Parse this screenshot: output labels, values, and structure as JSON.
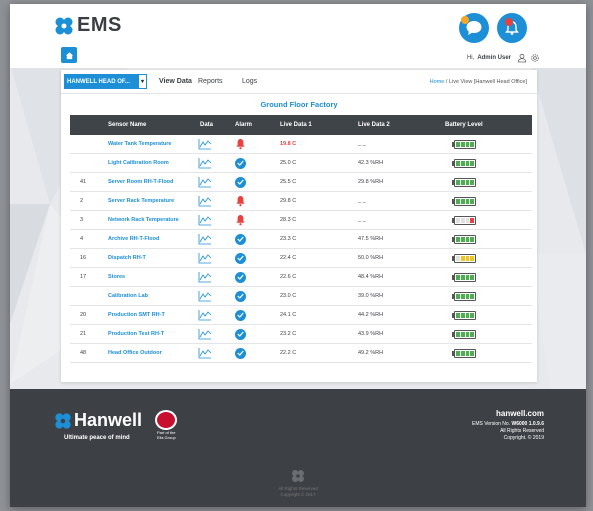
{
  "header": {
    "app_name": "EMS",
    "greeting": "Hi,",
    "user_name": "Admin User",
    "colors": {
      "accent": "#1c8fd6",
      "chat_badge": "#f5a623",
      "bell_badge": "#e8413e"
    }
  },
  "nav": {
    "site_select": "HANWELL HEAD OF...",
    "tabs": [
      {
        "label": "View Data",
        "active": true
      },
      {
        "label": "Reports",
        "active": false
      },
      {
        "label": "Logs",
        "active": false
      }
    ],
    "breadcrumb_home": "Home",
    "breadcrumb_sep": " / ",
    "breadcrumb_current": "Live View [Hanwell Head Office]"
  },
  "section_title": "Ground Floor Factory",
  "table": {
    "headers": {
      "sensor_name": "Sensor Name",
      "data": "Data",
      "alarm": "Alarm",
      "live1": "Live Data 1",
      "live2": "Live Data 2",
      "battery": "Battery Level"
    },
    "rows": [
      {
        "id": "",
        "name": "Water Tank Temperature",
        "alarm": "alarm",
        "live1": "19.8 C",
        "live2": "_ _",
        "battery": {
          "level": 4,
          "color": "#4caf50"
        }
      },
      {
        "id": "",
        "name": "Light Calibration Room",
        "alarm": "ok",
        "live1": "25.0 C",
        "live2": "42.3 %RH",
        "battery": {
          "level": 4,
          "color": "#4caf50"
        }
      },
      {
        "id": "41",
        "name": "Server Room RH-T-Flood",
        "alarm": "ok",
        "live1": "25.5 C",
        "live2": "29.8 %RH",
        "battery": {
          "level": 4,
          "color": "#4caf50"
        }
      },
      {
        "id": "2",
        "name": "Server Rack Temperature",
        "alarm": "alarm",
        "live1": "29.8 C",
        "live2": "_ _",
        "battery": {
          "level": 4,
          "color": "#4caf50"
        }
      },
      {
        "id": "3",
        "name": "Network Rack Temperature",
        "alarm": "alarm",
        "live1": "28.3 C",
        "live2": "_ _",
        "battery": {
          "level": 1,
          "color": "#e8413e"
        }
      },
      {
        "id": "4",
        "name": "Archive RH-T-Flood",
        "alarm": "ok",
        "live1": "23.3 C",
        "live2": "47.5 %RH",
        "battery": {
          "level": 4,
          "color": "#4caf50"
        }
      },
      {
        "id": "16",
        "name": "Dispatch RH-T",
        "alarm": "ok",
        "live1": "22.4 C",
        "live2": "50.0 %RH",
        "battery": {
          "level": 3,
          "color": "#f0c419"
        }
      },
      {
        "id": "17",
        "name": "Stores",
        "alarm": "ok",
        "live1": "22.6 C",
        "live2": "48.4 %RH",
        "battery": {
          "level": 4,
          "color": "#4caf50"
        }
      },
      {
        "id": "",
        "name": "Calibration Lab",
        "alarm": "ok",
        "live1": "23.0 C",
        "live2": "39.0 %RH",
        "battery": {
          "level": 4,
          "color": "#4caf50"
        }
      },
      {
        "id": "20",
        "name": "Production SMT RH-T",
        "alarm": "ok",
        "live1": "24.1 C",
        "live2": "44.2 %RH",
        "battery": {
          "level": 4,
          "color": "#4caf50"
        }
      },
      {
        "id": "21",
        "name": "Production Test RH-T",
        "alarm": "ok",
        "live1": "23.2 C",
        "live2": "43.9 %RH",
        "battery": {
          "level": 4,
          "color": "#4caf50"
        }
      },
      {
        "id": "48",
        "name": "Head Office Outdoor",
        "alarm": "ok",
        "live1": "22.2 C",
        "live2": "49.2 %RH",
        "battery": {
          "level": 4,
          "color": "#4caf50"
        }
      }
    ]
  },
  "footer": {
    "brand": "Hanwell",
    "tagline": "Ultimate peace of mind",
    "part_of_1": "Part of the",
    "part_of_2": "Elis Group",
    "site": "hanwell.com",
    "version_label": "EMS Version No.",
    "version": "W6000 1.0.9.6",
    "rights": "All Rights Reserved",
    "copyright": "Copyright. © 2019",
    "center_rights": "All Rights Reserved",
    "center_copyright": "Copyright © 2017"
  }
}
